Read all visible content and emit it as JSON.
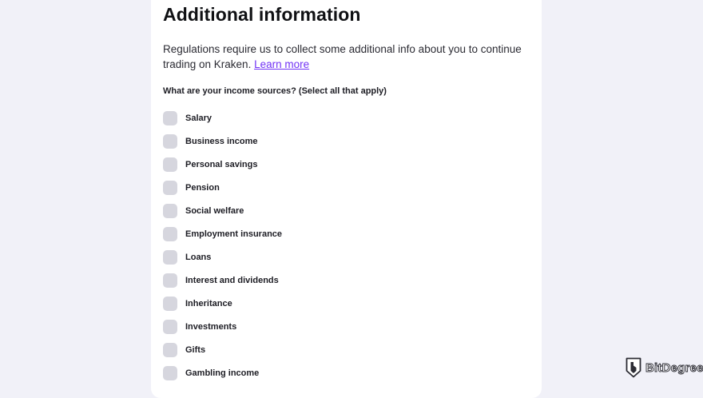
{
  "page": {
    "title": "Additional information",
    "intro_text": "Regulations require us to collect some additional info about you to continue trading on Kraken. ",
    "learn_more_link": "Learn more",
    "question": "What are your income sources? (Select all that apply)"
  },
  "income_sources": [
    {
      "label": "Salary",
      "checked": false
    },
    {
      "label": "Business income",
      "checked": false
    },
    {
      "label": "Personal savings",
      "checked": false
    },
    {
      "label": "Pension",
      "checked": false
    },
    {
      "label": "Social welfare",
      "checked": false
    },
    {
      "label": "Employment insurance",
      "checked": false
    },
    {
      "label": "Loans",
      "checked": false
    },
    {
      "label": "Interest and dividends",
      "checked": false
    },
    {
      "label": "Inheritance",
      "checked": false
    },
    {
      "label": "Investments",
      "checked": false
    },
    {
      "label": "Gifts",
      "checked": false
    },
    {
      "label": "Gambling income",
      "checked": false
    }
  ],
  "watermark": {
    "text": "BitDegree",
    "icon": "bitdegree-shield-icon"
  },
  "colors": {
    "background": "#f1f1f8",
    "card": "#ffffff",
    "link": "#7132f5",
    "checkbox": "#d6d6de",
    "text": "#1d1d24"
  }
}
